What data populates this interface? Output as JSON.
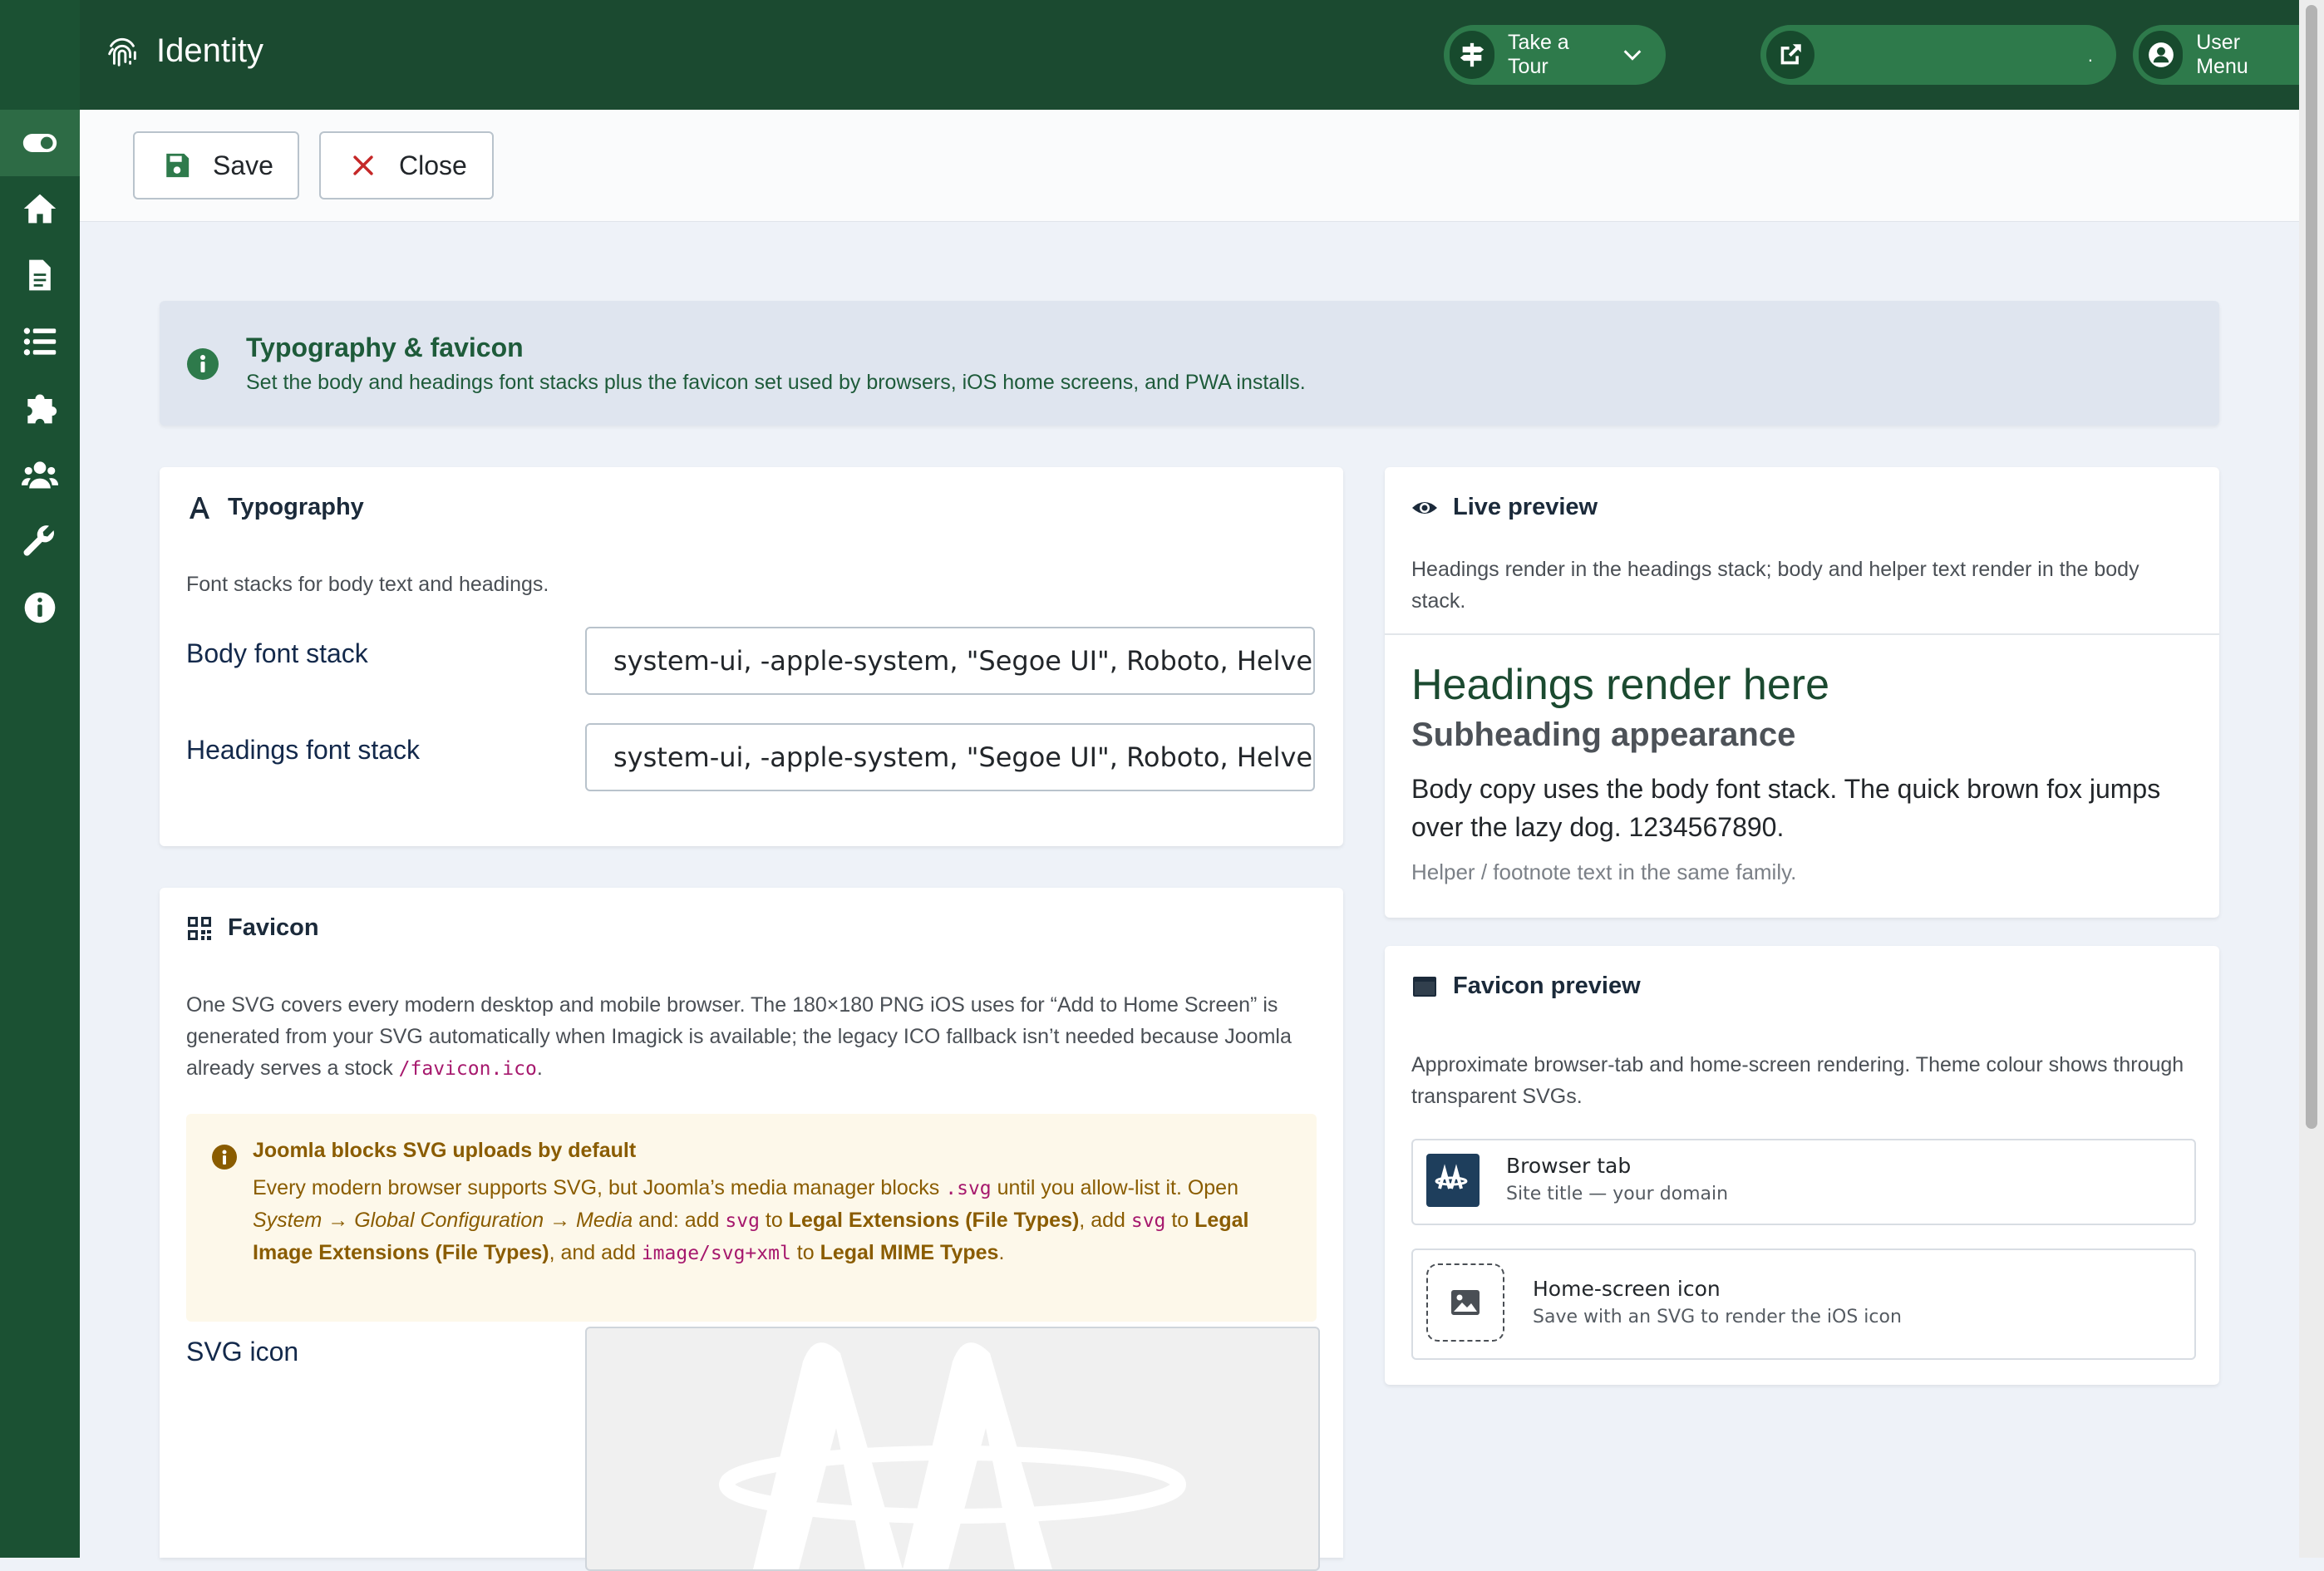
{
  "app": {
    "title": "Identity"
  },
  "header": {
    "tour_label": "Take a Tour",
    "site_label": ".",
    "user_label": "User Menu"
  },
  "toolbar": {
    "save_label": "Save",
    "close_label": "Close"
  },
  "alert": {
    "title": "Typography & favicon",
    "text": "Set the body and headings font stacks plus the favicon set used by browsers, iOS home screens, and PWA installs."
  },
  "typography": {
    "title": "Typography",
    "description": "Font stacks for body text and headings.",
    "body_label": "Body font stack",
    "body_value": "system-ui, -apple-system, \"Segoe UI\", Roboto, Helvetica, Arial, sans-serif",
    "headings_label": "Headings font stack",
    "headings_value": "system-ui, -apple-system, \"Segoe UI\", Roboto, Helvetica, Arial, sans-serif"
  },
  "favicon": {
    "title": "Favicon",
    "desc_1": "One SVG covers every modern desktop and mobile browser. The 180×180 PNG iOS uses for “Add to Home Screen” is generated from your SVG automatically when Imagick is available; the legacy ICO fallback isn’t needed because Joomla already serves a stock ",
    "desc_code": "/favicon.ico",
    "desc_2": ".",
    "warn_title": "Joomla blocks SVG uploads by default",
    "warn_1": "Every modern browser supports SVG, but Joomla’s media manager blocks ",
    "warn_code_1": ".svg",
    "warn_2": " until you allow-list it. Open ",
    "warn_path": "System → Global Configuration → Media",
    "warn_3": " and: add ",
    "warn_code_2": "svg",
    "warn_4": " to ",
    "warn_b1": "Legal Extensions (File Types)",
    "warn_5": ", add ",
    "warn_code_3": "svg",
    "warn_6": " to ",
    "warn_b2": "Legal Image Extensions (File Types)",
    "warn_7": ", and add ",
    "warn_code_4": "image/svg+xml",
    "warn_8": " to ",
    "warn_b3": "Legal MIME Types",
    "warn_9": ".",
    "svg_label": "SVG icon"
  },
  "live_preview": {
    "title": "Live preview",
    "description": "Headings render in the headings stack; body and helper text render in the body stack.",
    "heading": "Headings render here",
    "subheading": "Subheading appearance",
    "body": "Body copy uses the body font stack. The quick brown fox jumps over the lazy dog. 1234567890.",
    "helper": "Helper / footnote text in the same family."
  },
  "favicon_preview": {
    "title": "Favicon preview",
    "description": "Approximate browser-tab and home-screen rendering. Theme colour shows through transparent SVGs.",
    "tab_title": "Browser tab",
    "tab_sub": "Site title — your domain",
    "home_title": "Home-screen icon",
    "home_sub": "Save with an SVG to render the iOS icon"
  },
  "colors": {
    "sidebar": "#1b5133",
    "header": "#1b4a30",
    "accent": "#2e7a4b",
    "tile": "#1e3e5c"
  }
}
